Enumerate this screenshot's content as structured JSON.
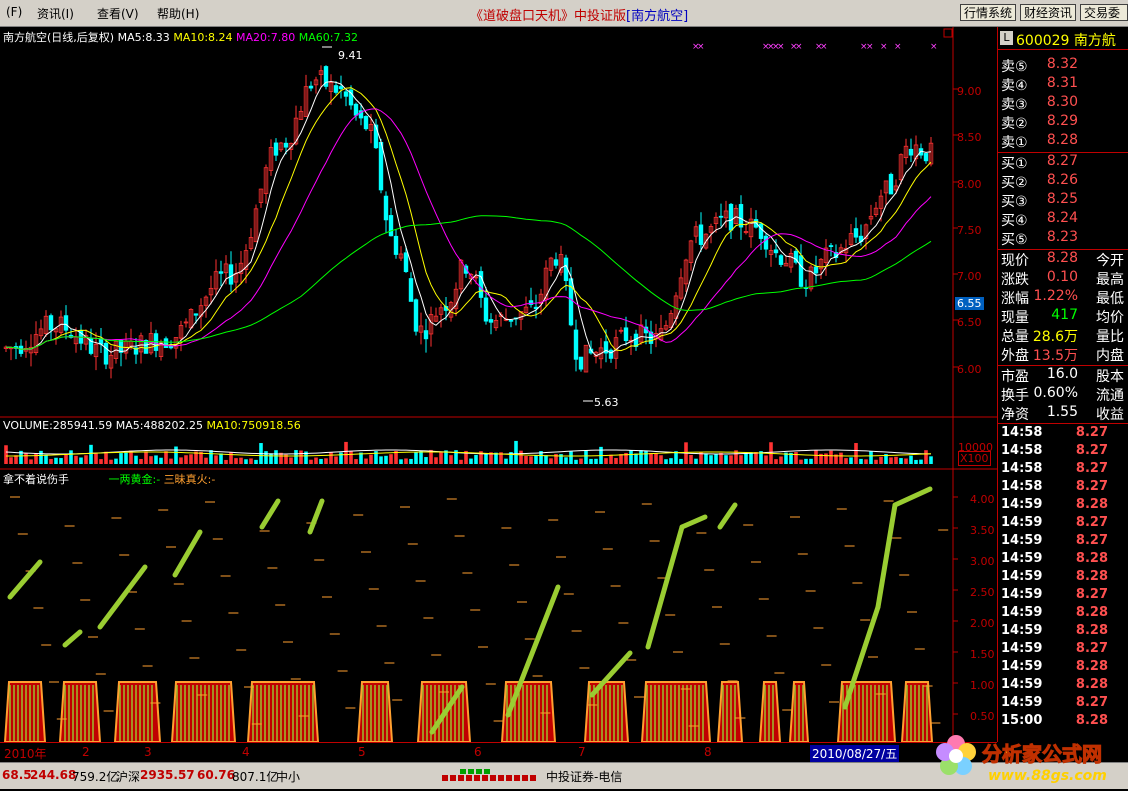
{
  "menu": {
    "items": [
      "资讯(I)",
      "查看(V)",
      "帮助(H)"
    ],
    "file_btn": "(F)"
  },
  "window_title": {
    "main": "《道破盘口天机》中投证版",
    "stock": "[南方航空]"
  },
  "top_buttons": [
    "行情系统",
    "财经资讯",
    "交易委"
  ],
  "main_chart": {
    "title": "南方航空(日线,后复权)",
    "ma5": "MA5:8.33",
    "ma10": "MA10:8.24",
    "ma20": "MA20:7.80",
    "ma60": "MA60:7.32",
    "high_label": "9.41",
    "low_label": "5.63",
    "current_price_tag": "6.55",
    "y_ticks": [
      "9.00",
      "8.50",
      "8.00",
      "7.50",
      "7.00",
      "6.50",
      "6.00"
    ]
  },
  "volume": {
    "label": "VOLUME:285941.59",
    "ma5": "MA5:488202.25",
    "ma10": "MA10:750918.56",
    "axis": "10000",
    "unit": "X100"
  },
  "indicator": {
    "title": "拿不着说伤手",
    "l1": "一两黄金:-",
    "l2": "三昧真火:-",
    "y_ticks": [
      "4.00",
      "3.50",
      "3.00",
      "2.50",
      "2.00",
      "1.50",
      "1.00",
      "0.50"
    ]
  },
  "x_axis": {
    "labels": [
      "2010年",
      "2",
      "3",
      "4",
      "5",
      "6",
      "7",
      "8"
    ],
    "date": "2010/08/27/五"
  },
  "quote": {
    "code": "600029",
    "name": "南方航",
    "sell": [
      [
        "卖⑤",
        "8.32"
      ],
      [
        "卖④",
        "8.31"
      ],
      [
        "卖③",
        "8.30"
      ],
      [
        "卖②",
        "8.29"
      ],
      [
        "卖①",
        "8.28"
      ]
    ],
    "buy": [
      [
        "买①",
        "8.27"
      ],
      [
        "买②",
        "8.26"
      ],
      [
        "买③",
        "8.25"
      ],
      [
        "买④",
        "8.24"
      ],
      [
        "买⑤",
        "8.23"
      ]
    ],
    "stats": [
      [
        "现价",
        "8.28",
        "今开"
      ],
      [
        "涨跌",
        "0.10",
        "最高"
      ],
      [
        "涨幅",
        "1.22%",
        "最低"
      ],
      [
        "现量",
        "417",
        "均价"
      ],
      [
        "总量",
        "28.6万",
        "量比"
      ],
      [
        "外盘",
        "13.5万",
        "内盘"
      ]
    ],
    "fund": [
      [
        "市盈",
        "16.0",
        "股本"
      ],
      [
        "换手",
        "0.60%",
        "流通"
      ],
      [
        "净资",
        "1.55",
        "收益"
      ]
    ],
    "ticks": [
      [
        "14:58",
        "8.27"
      ],
      [
        "14:58",
        "8.27"
      ],
      [
        "14:58",
        "8.27"
      ],
      [
        "14:58",
        "8.27"
      ],
      [
        "14:59",
        "8.28"
      ],
      [
        "14:59",
        "8.27"
      ],
      [
        "14:59",
        "8.27"
      ],
      [
        "14:59",
        "8.28"
      ],
      [
        "14:59",
        "8.28"
      ],
      [
        "14:59",
        "8.27"
      ],
      [
        "14:59",
        "8.28"
      ],
      [
        "14:59",
        "8.28"
      ],
      [
        "14:59",
        "8.27"
      ],
      [
        "14:59",
        "8.28"
      ],
      [
        "14:59",
        "8.28"
      ],
      [
        "14:59",
        "8.27"
      ],
      [
        "15:00",
        "8.28"
      ]
    ]
  },
  "status": {
    "sh_tail": "68.5",
    "sh_chg": "244.68",
    "sh_amt": "759.2亿",
    "hs_label": "沪深",
    "hs_val": "2935.57",
    "hs_chg": "60.76",
    "hs_amt": "807.1亿",
    "size": "中小",
    "broker": "中投证券-电信"
  },
  "logo": {
    "text": "分析家公式网",
    "url": "www.88gs.com"
  },
  "colors": {
    "up": "#ff3232",
    "down": "#00ffff",
    "ma5": "#ffffff",
    "ma10": "#ffff00",
    "ma20": "#ff00ff",
    "ma60": "#00ff00"
  }
}
